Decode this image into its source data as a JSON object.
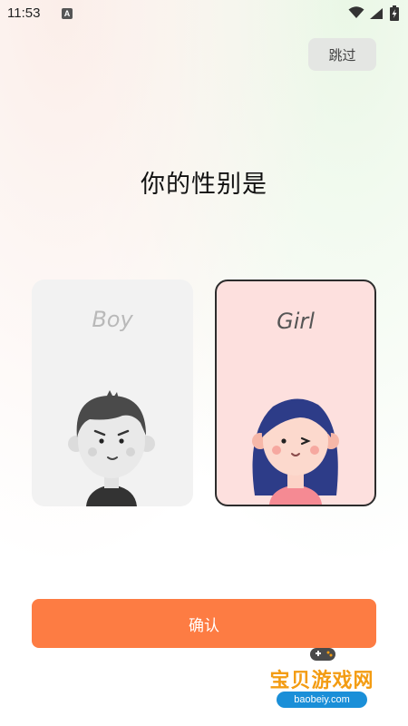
{
  "status_bar": {
    "time": "11:53",
    "notification_icon": "A"
  },
  "header": {
    "skip_label": "跳过"
  },
  "question": "你的性别是",
  "options": [
    {
      "label": "Boy",
      "selected": false,
      "icon": "boy-avatar-icon"
    },
    {
      "label": "Girl",
      "selected": true,
      "icon": "girl-avatar-icon"
    }
  ],
  "confirm_label": "确认",
  "watermark": {
    "title": "宝贝游戏网",
    "url": "baobeiy.com"
  },
  "colors": {
    "accent": "#fd7c43",
    "girl_card": "#fde0de",
    "boy_card": "#f2f2f2",
    "skip_bg": "#e4e6e3"
  }
}
